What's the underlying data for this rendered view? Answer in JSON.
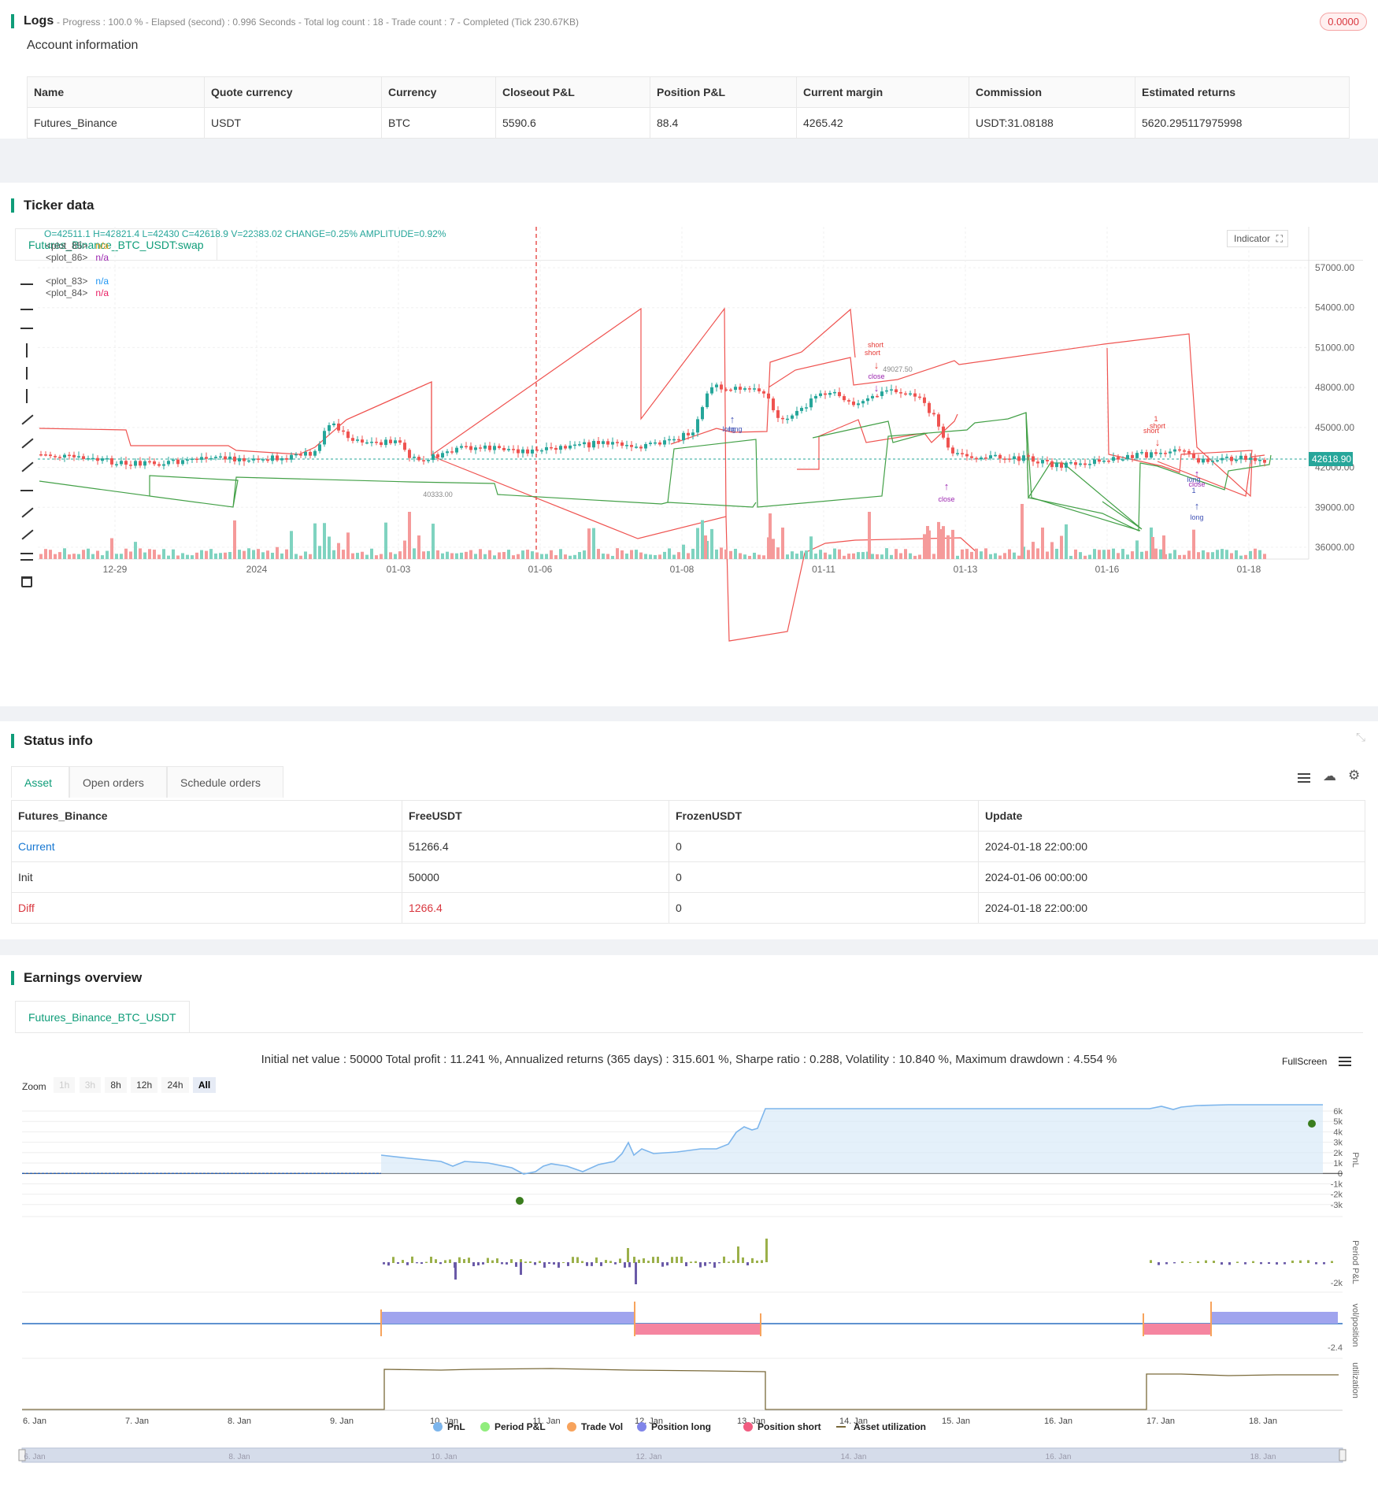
{
  "logs": {
    "title": "Logs",
    "info": "- Progress : 100.0 % - Elapsed (second) : 0.996 Seconds - Total log count : 18 - Trade count : 7 - Completed (Tick 230.67KB)",
    "badge": "0.0000"
  },
  "account": {
    "title": "Account information",
    "headers": [
      "Name",
      "Quote currency",
      "Currency",
      "Closeout P&L",
      "Position P&L",
      "Current margin",
      "Commission",
      "Estimated returns"
    ],
    "row": [
      "Futures_Binance",
      "USDT",
      "BTC",
      "5590.6",
      "88.4",
      "4265.42",
      "USDT:31.08188",
      "5620.295117975998"
    ]
  },
  "ticker": {
    "title": "Ticker data",
    "tab": "Futures_Binance_BTC_USDT:swap",
    "ohlc": "O=42511.1 H=42821.4 L=42430 C=42618.9 V=22383.02 CHANGE=0.25% AMPLITUDE=0.92%",
    "legend": [
      {
        "name": "<plot_85>",
        "value": "n/a",
        "color": "#f0a020"
      },
      {
        "name": "<plot_86>",
        "value": "n/a",
        "color": "#9c27b0"
      },
      {
        "name": "<plot_83>",
        "value": "n/a",
        "color": "#2196f3"
      },
      {
        "name": "<plot_84>",
        "value": "n/a",
        "color": "#e91e63"
      }
    ],
    "indicator_label": "Indicator",
    "price_label": "42618.90",
    "y_ticks": [
      "57000.00",
      "54000.00",
      "51000.00",
      "48000.00",
      "45000.00",
      "42000.00",
      "39000.00",
      "36000.00"
    ],
    "x_ticks": [
      "12-29",
      "2024",
      "01-03",
      "01-06",
      "01-08",
      "01-11",
      "01-13",
      "01-16",
      "01-18"
    ],
    "annotations": {
      "short1": "short",
      "short1b": "short",
      "price_hi": "49027.50",
      "close1": "close",
      "long1": "long",
      "long1b": "long",
      "price_lo": "40333.00",
      "close2": "close",
      "short2": "short",
      "short2b": "short",
      "one1": "1",
      "one2": "1",
      "long2": "long",
      "long2b": "long",
      "close3": "close",
      "long3": "long"
    }
  },
  "status": {
    "title": "Status info",
    "tabs": [
      "Asset",
      "Open orders",
      "Schedule orders"
    ],
    "headers": [
      "Futures_Binance",
      "FreeUSDT",
      "FrozenUSDT",
      "Update"
    ],
    "rows": [
      {
        "label": "Current",
        "free": "51266.4",
        "frozen": "0",
        "update": "2024-01-18 22:00:00"
      },
      {
        "label": "Init",
        "free": "50000",
        "frozen": "0",
        "update": "2024-01-06 00:00:00"
      },
      {
        "label": "Diff",
        "free": "1266.4",
        "frozen": "0",
        "update": "2024-01-18 22:00:00"
      }
    ]
  },
  "earnings": {
    "title": "Earnings overview",
    "tab": "Futures_Binance_BTC_USDT",
    "summary": "Initial net value : 50000 Total profit : 11.241 %, Annualized returns (365 days) : 315.601 %, Sharpe ratio : 0.288, Volatility : 10.840 %, Maximum drawdown : 4.554 %",
    "fullscreen": "FullScreen",
    "zoom_label": "Zoom",
    "zoom_options": [
      "1h",
      "3h",
      "8h",
      "12h",
      "24h",
      "All"
    ],
    "pnl_ticks": [
      "6k",
      "5k",
      "4k",
      "3k",
      "2k",
      "1k",
      "0",
      "-1k",
      "-2k",
      "-3k"
    ],
    "axis_labels": [
      "PnL",
      "Period P&L",
      "vol/position",
      "utilization"
    ],
    "period_tick": "-2k",
    "vol_tick": "-2.4",
    "x_ticks": [
      "6. Jan",
      "7. Jan",
      "8. Jan",
      "9. Jan",
      "10. Jan",
      "11. Jan",
      "12. Jan",
      "13. Jan",
      "14. Jan",
      "15. Jan",
      "16. Jan",
      "17. Jan",
      "18. Jan"
    ],
    "legend": [
      {
        "name": "PnL",
        "color": "#7cb5ec"
      },
      {
        "name": "Period P&L",
        "color": "#90ed7d"
      },
      {
        "name": "Trade Vol",
        "color": "#f7a35c"
      },
      {
        "name": "Position long",
        "color": "#8085e9"
      },
      {
        "name": "Position short",
        "color": "#f15c80"
      },
      {
        "name": "Asset utilization",
        "color": "#7a6a3a"
      }
    ],
    "navigator_ticks": [
      "6. Jan",
      "8. Jan",
      "10. Jan",
      "12. Jan",
      "14. Jan",
      "16. Jan",
      "18. Jan"
    ]
  }
}
